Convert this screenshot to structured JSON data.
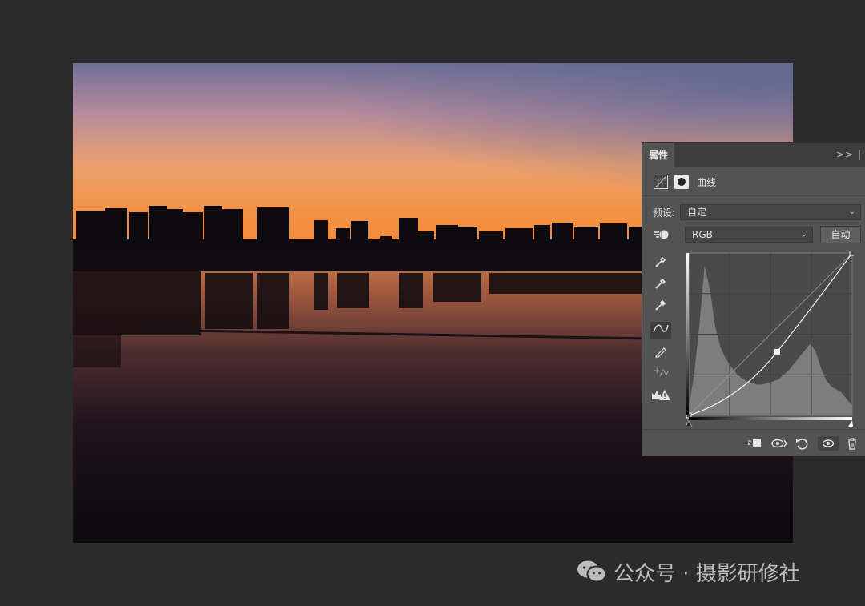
{
  "panel": {
    "tab_label": "属性",
    "collapse_glyph": ">> |",
    "adjustment_type": "曲线",
    "preset_label": "预设:",
    "preset_value": "自定",
    "channel_value": "RGB",
    "auto_label": "自动"
  },
  "curve": {
    "input_range": [
      0,
      255
    ],
    "output_range": [
      0,
      255
    ],
    "points": [
      [
        0,
        0
      ],
      [
        138,
        100
      ],
      [
        255,
        255
      ]
    ],
    "histogram_peaks": [
      "shadows",
      "highlights"
    ]
  },
  "icons": {
    "tab_collapse": "double-chevron-right-icon",
    "curves_adjustment": "curves-icon",
    "layer_mask": "mask-icon",
    "on_image_adjust": "targeted-adjustment-hand-icon",
    "eyedropper_black": "black-point-eyedropper-icon",
    "eyedropper_gray": "gray-point-eyedropper-icon",
    "eyedropper_white": "white-point-eyedropper-icon",
    "edit_points": "curve-point-tool-icon",
    "draw": "pencil-icon",
    "smooth": "smooth-curve-icon",
    "clipping_warning": "clipping-warning-icon",
    "clip_to_layer": "clip-to-layer-icon",
    "view_previous": "view-previous-state-icon",
    "reset": "reset-icon",
    "visibility": "eye-icon",
    "delete": "trash-icon"
  },
  "colors": {
    "workspace": "#2b2b2b",
    "panel": "#535353",
    "sky_top": "#7a7a9c",
    "sky_horizon": "#f28c3c",
    "water_dark": "#0d080d"
  },
  "watermark": {
    "text": "公众号 · 摄影研修社"
  }
}
